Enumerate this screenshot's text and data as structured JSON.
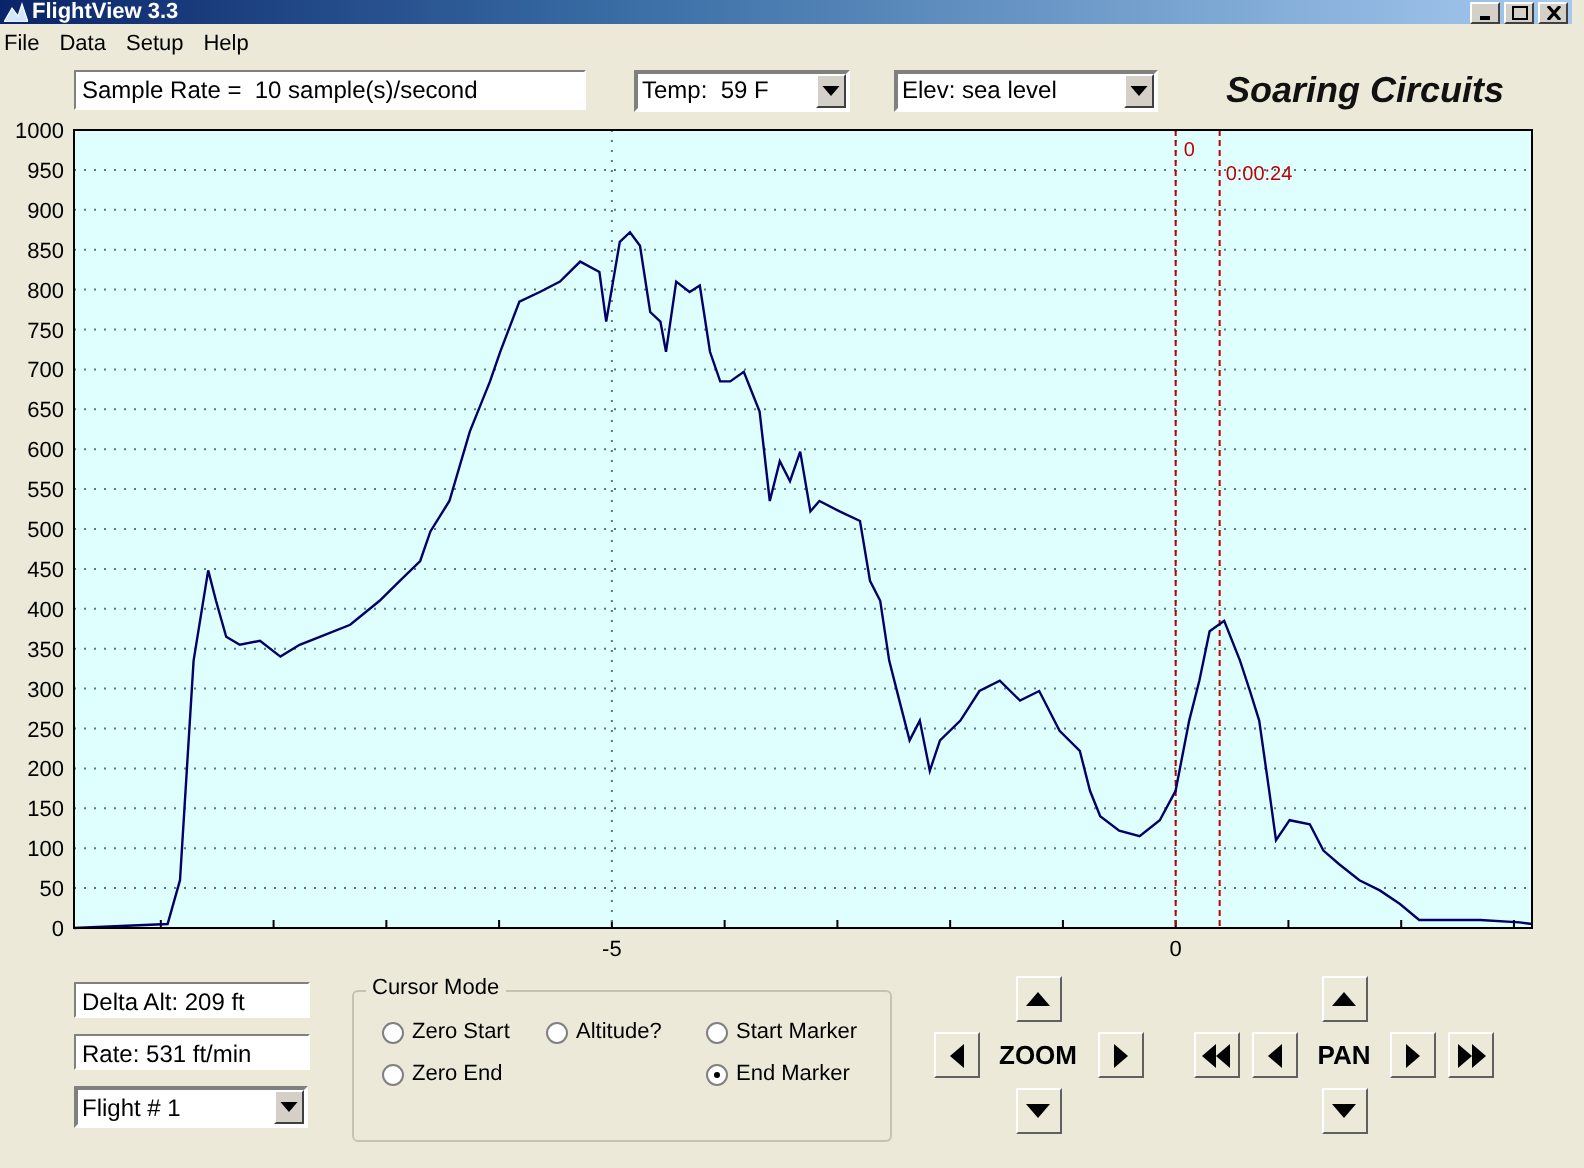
{
  "window": {
    "title": "FlightView 3.3"
  },
  "menu": [
    "File",
    "Data",
    "Setup",
    "Help"
  ],
  "toolbar": {
    "sample_rate": "Sample Rate =  10 sample(s)/second",
    "temperature": "Temp:  59 F",
    "elevation": "Elev: sea level",
    "logo": "Soaring Circuits"
  },
  "chart": {
    "chart_data": {
      "type": "line",
      "xlim": [
        -9.77,
        3.16
      ],
      "ylim": [
        0,
        1000
      ],
      "xticks": [
        -5,
        0
      ],
      "yticks": [
        0,
        50,
        100,
        150,
        200,
        250,
        300,
        350,
        400,
        450,
        500,
        550,
        600,
        650,
        700,
        750,
        800,
        850,
        900,
        950,
        1000
      ],
      "x": [
        -9.77,
        -8.94,
        -8.83,
        -8.71,
        -8.58,
        -8.51,
        -8.42,
        -8.3,
        -8.12,
        -7.94,
        -7.77,
        -7.59,
        -7.32,
        -7.06,
        -6.88,
        -6.7,
        -6.61,
        -6.44,
        -6.26,
        -6.08,
        -5.99,
        -5.82,
        -5.64,
        -5.46,
        -5.28,
        -5.11,
        -5.05,
        -4.93,
        -4.84,
        -4.75,
        -4.66,
        -4.57,
        -4.52,
        -4.43,
        -4.31,
        -4.22,
        -4.13,
        -4.04,
        -3.95,
        -3.83,
        -3.69,
        -3.6,
        -3.51,
        -3.42,
        -3.33,
        -3.24,
        -3.16,
        -2.98,
        -2.8,
        -2.71,
        -2.62,
        -2.54,
        -2.45,
        -2.36,
        -2.27,
        -2.18,
        -2.09,
        -1.91,
        -1.74,
        -1.56,
        -1.38,
        -1.21,
        -1.03,
        -0.85,
        -0.76,
        -0.67,
        -0.5,
        -0.32,
        -0.14,
        0,
        0.12,
        0.21,
        0.3,
        0.43,
        0.57,
        0.66,
        0.74,
        0.83,
        0.89,
        1.01,
        1.19,
        1.31,
        1.45,
        1.63,
        1.81,
        1.99,
        2.16,
        2.34,
        2.7,
        3.05,
        3.16
      ],
      "grid": true,
      "series": [
        {
          "color": "#000066",
          "values": [
            0,
            5,
            60,
            335,
            448,
            410,
            365,
            355,
            360,
            340,
            355,
            365,
            380,
            410,
            435,
            460,
            497,
            535,
            622,
            685,
            722,
            785,
            797,
            810,
            835,
            822,
            760,
            860,
            872,
            855,
            772,
            760,
            722,
            810,
            797,
            805,
            722,
            685,
            685,
            697,
            647,
            535,
            585,
            560,
            597,
            522,
            535,
            522,
            510,
            435,
            410,
            335,
            285,
            235,
            260,
            197,
            235,
            260,
            297,
            310,
            285,
            297,
            247,
            222,
            172,
            140,
            122,
            115,
            135,
            172,
            260,
            310,
            372,
            385,
            335,
            297,
            260,
            172,
            110,
            135,
            130,
            97,
            80,
            60,
            47,
            30,
            10,
            10,
            10,
            7,
            5
          ]
        }
      ],
      "ref_lines": [
        {
          "axis": "x",
          "value": 0,
          "label": "0",
          "color": "#c00000"
        },
        {
          "axis": "x",
          "value": 0.39,
          "label": "0:00:24",
          "color": "#c00000"
        }
      ]
    }
  },
  "readouts": {
    "delta_alt": "Delta Alt: 209 ft",
    "rate": "Rate: 531 ft/min",
    "flight": "Flight # 1"
  },
  "cursor_mode": {
    "title": "Cursor Mode",
    "columns": [
      [
        {
          "label": "Zero Start",
          "selected": false
        },
        {
          "label": "Zero End",
          "selected": false
        }
      ],
      [
        {
          "label": "Altitude?",
          "selected": false
        }
      ],
      [
        {
          "label": "Start Marker",
          "selected": false
        },
        {
          "label": "End Marker",
          "selected": true
        }
      ]
    ]
  },
  "zoom": {
    "label": "ZOOM"
  },
  "pan": {
    "label": "PAN"
  }
}
